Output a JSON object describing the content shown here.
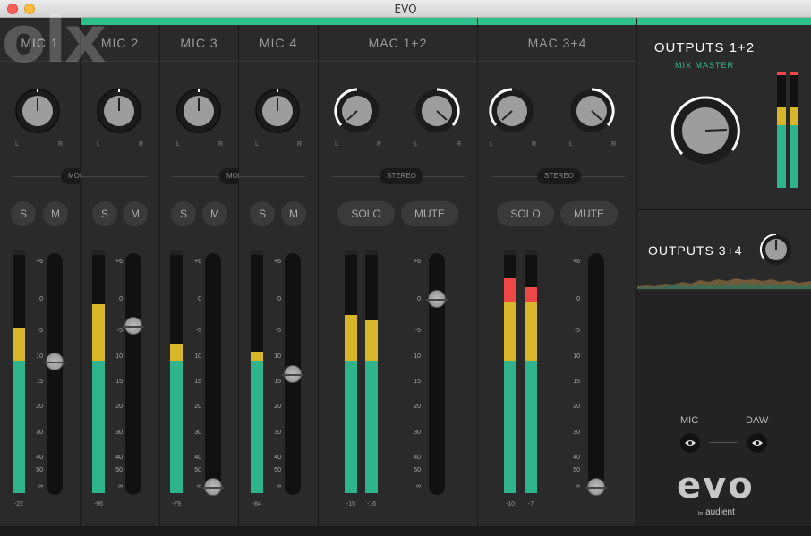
{
  "window": {
    "title": "EVO",
    "watermark": "olx"
  },
  "colors": {
    "accent": "#2fbf8c",
    "meter_green": "#2fb38a",
    "meter_yellow": "#d8b62a",
    "meter_red": "#f04848"
  },
  "channels": [
    {
      "name": "MIC 1",
      "mode": "MONO",
      "buttons": [
        "S",
        "M"
      ],
      "meter_peak": "-22"
    },
    {
      "name": "MIC 2",
      "buttons": [
        "S",
        "M"
      ],
      "meter_peak": "-96"
    },
    {
      "name": "MIC 3",
      "mode": "MONO",
      "buttons": [
        "S",
        "M"
      ],
      "meter_peak": "-79"
    },
    {
      "name": "MIC 4",
      "buttons": [
        "S",
        "M"
      ],
      "meter_peak": "-84"
    },
    {
      "name": "MAC 1+2",
      "mode": "STEREO",
      "buttons": [
        "SOLO",
        "MUTE"
      ],
      "meter_peaks": [
        "-15",
        "-16"
      ]
    },
    {
      "name": "MAC 3+4",
      "mode": "STEREO",
      "buttons": [
        "SOLO",
        "MUTE"
      ],
      "meter_peaks": [
        "-10",
        "-7"
      ]
    }
  ],
  "pan": {
    "left": "L",
    "right": "R"
  },
  "scale_ticks": [
    "+6",
    "0",
    "-5",
    "10",
    "15",
    "20",
    "30",
    "40",
    "50",
    "∞"
  ],
  "outputs": {
    "main_title": "OUTPUTS 1+2",
    "main_subtitle": "MIX MASTER",
    "secondary_title": "OUTPUTS 3+4",
    "source_mic": "MIC",
    "source_daw": "DAW"
  },
  "logo": {
    "wordmark": "evo",
    "by": "by",
    "brand": "audient"
  }
}
